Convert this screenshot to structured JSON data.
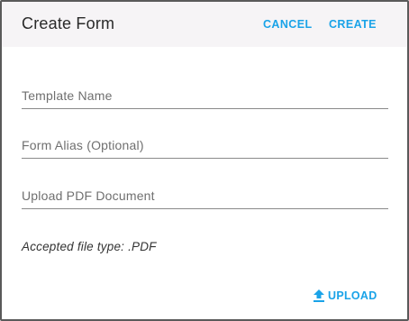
{
  "dialog": {
    "title": "Create Form",
    "cancel_label": "CANCEL",
    "create_label": "CREATE"
  },
  "fields": {
    "template_name": {
      "placeholder": "Template Name",
      "value": ""
    },
    "form_alias": {
      "placeholder": "Form Alias (Optional)",
      "value": ""
    },
    "pdf_document": {
      "placeholder": "Upload PDF Document",
      "value": ""
    }
  },
  "accepted_file_type": "Accepted file type: .PDF",
  "upload": {
    "label": "UPLOAD",
    "icon": "upload-icon"
  },
  "colors": {
    "accent": "#1aa3e8",
    "header_bg": "#f6f4f6",
    "border": "#5a5a5a"
  }
}
